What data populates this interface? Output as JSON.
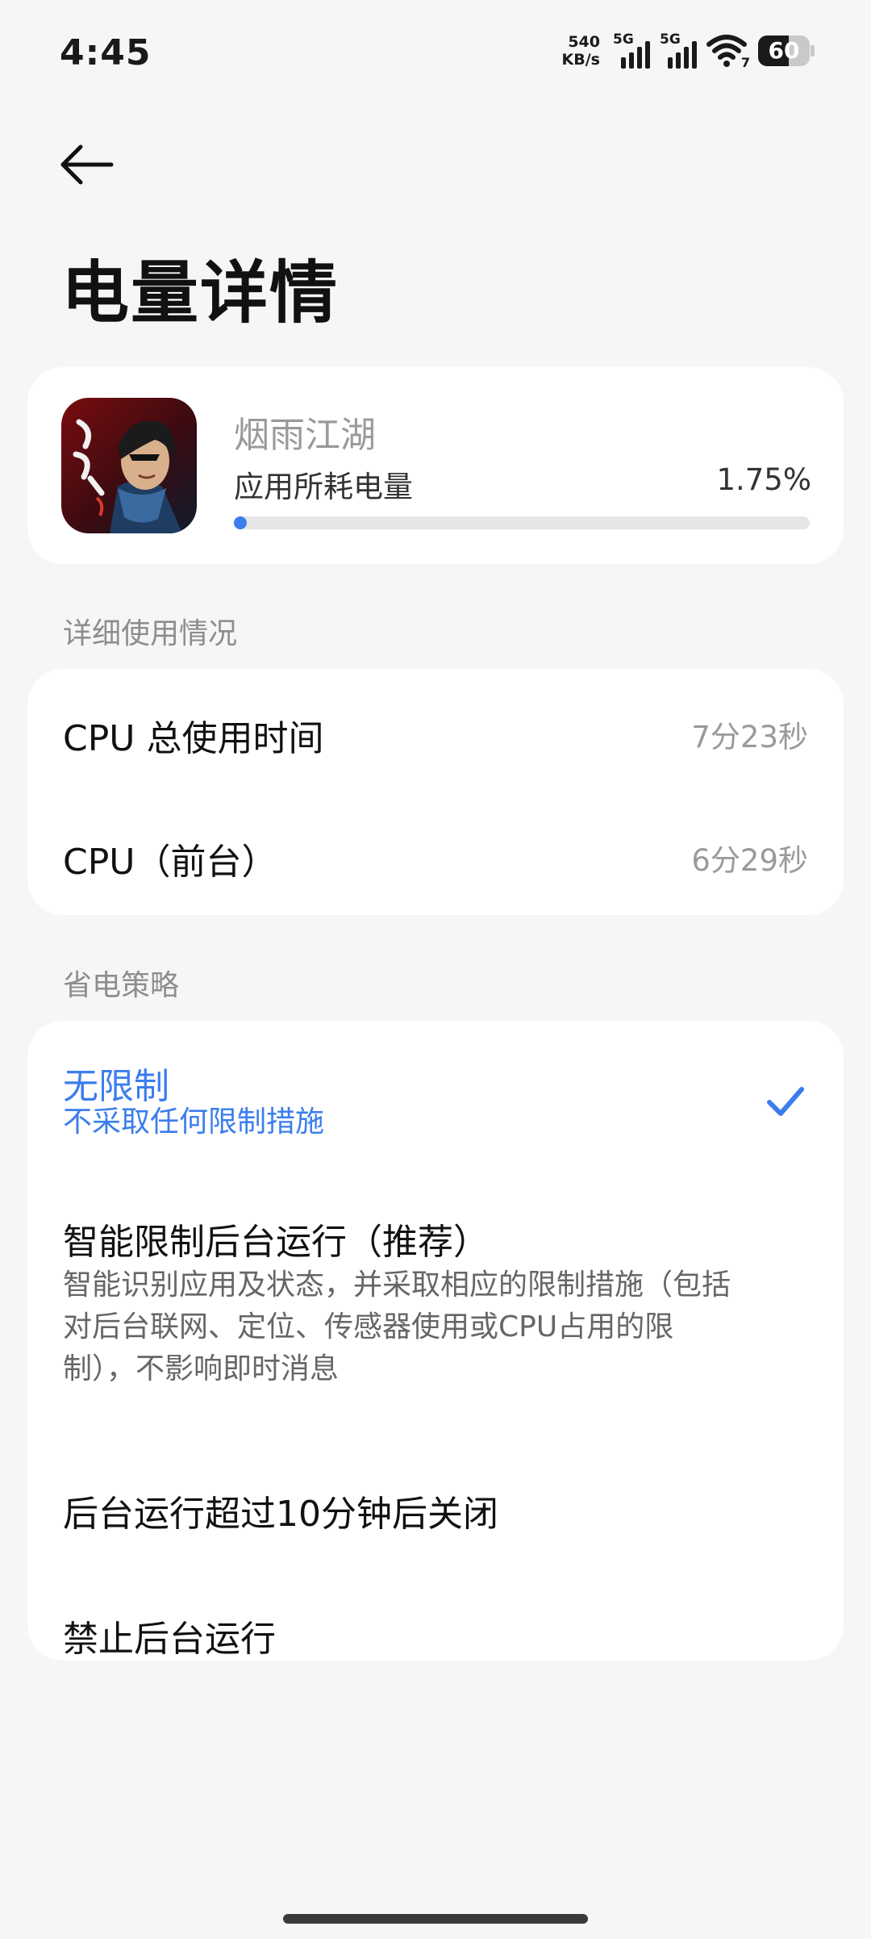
{
  "status_bar": {
    "time": "4:45",
    "net_speed_value": "540",
    "net_speed_unit": "KB/s",
    "sim1_tag": "5G",
    "sim2_tag": "5G",
    "wifi_tag": "7",
    "battery_level": "60",
    "battery_fraction": 0.6
  },
  "header": {
    "back_icon": "arrow-left-icon",
    "title": "电量详情"
  },
  "app": {
    "name": "烟雨江湖",
    "usage_label": "应用所耗电量",
    "usage_value": "1.75%",
    "usage_fraction": 0.0175,
    "accent_color": "#3b7ded"
  },
  "details": {
    "section_title": "详细使用情况",
    "rows": [
      {
        "label": "CPU 总使用时间",
        "value": "7分23秒"
      },
      {
        "label": "CPU（前台）",
        "value": "6分29秒"
      }
    ]
  },
  "policy": {
    "section_title": "省电策略",
    "options": [
      {
        "title": "无限制",
        "subtitle": "不采取任何限制措施",
        "selected": true
      },
      {
        "title": "智能限制后台运行（推荐）",
        "subtitle": "智能识别应用及状态，并采取相应的限制措施（包括对后台联网、定位、传感器使用或CPU占用的限制），不影响即时消息",
        "selected": false
      },
      {
        "title": "后台运行超过10分钟后关闭",
        "subtitle": "",
        "selected": false
      },
      {
        "title": "禁止后台运行",
        "subtitle": "",
        "selected": false
      }
    ]
  }
}
